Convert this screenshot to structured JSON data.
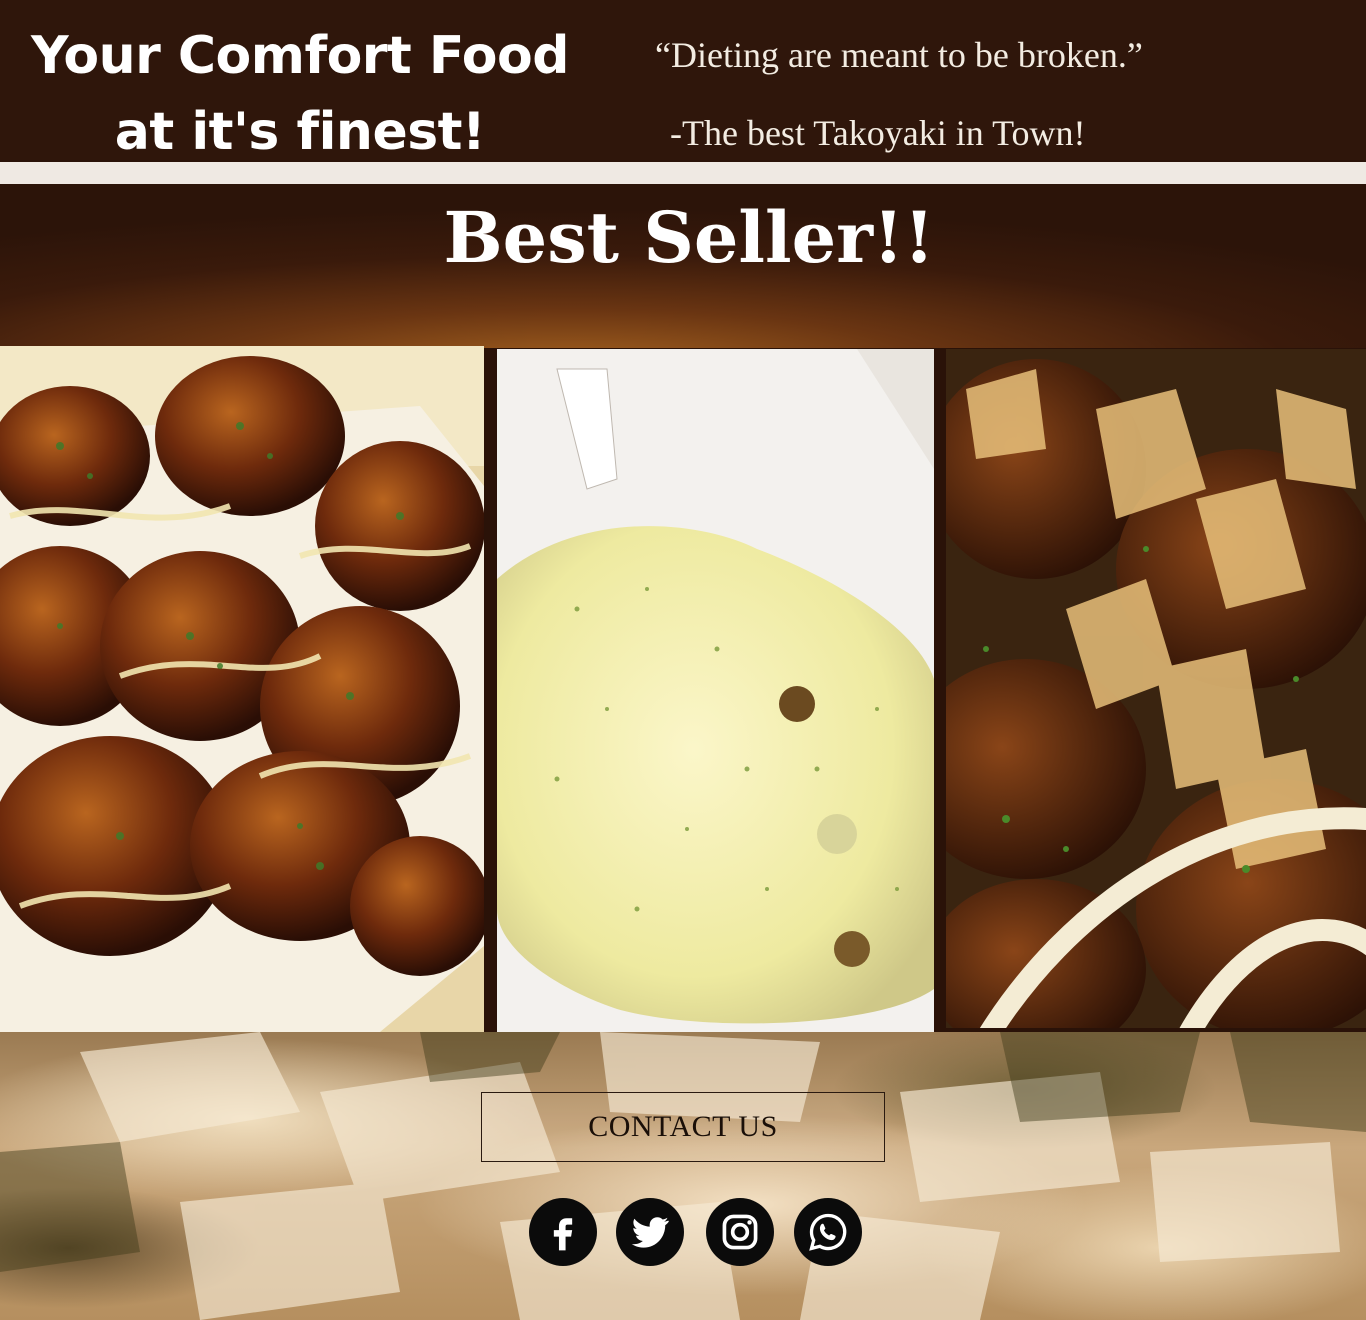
{
  "header": {
    "headline_line1": "Your Comfort Food",
    "headline_line2": "at it's finest!",
    "quote": "“Dieting are meant to be broken.”",
    "attribution": "-The best Takoyaki in Town!"
  },
  "best_seller": {
    "title": "Best Seller!!"
  },
  "photos": [
    {
      "icon": "takoyaki-sauce-photo"
    },
    {
      "icon": "takoyaki-cheese-photo"
    },
    {
      "icon": "takoyaki-bonito-photo"
    }
  ],
  "contact": {
    "label": "CONTACT US"
  },
  "social": [
    {
      "icon": "facebook-icon"
    },
    {
      "icon": "twitter-icon"
    },
    {
      "icon": "instagram-icon"
    },
    {
      "icon": "whatsapp-icon"
    }
  ],
  "colors": {
    "header_bg": "#2f160b",
    "divider": "#efe9e3",
    "text_light": "#ffffff",
    "icon_bg": "#0b0b0b"
  }
}
